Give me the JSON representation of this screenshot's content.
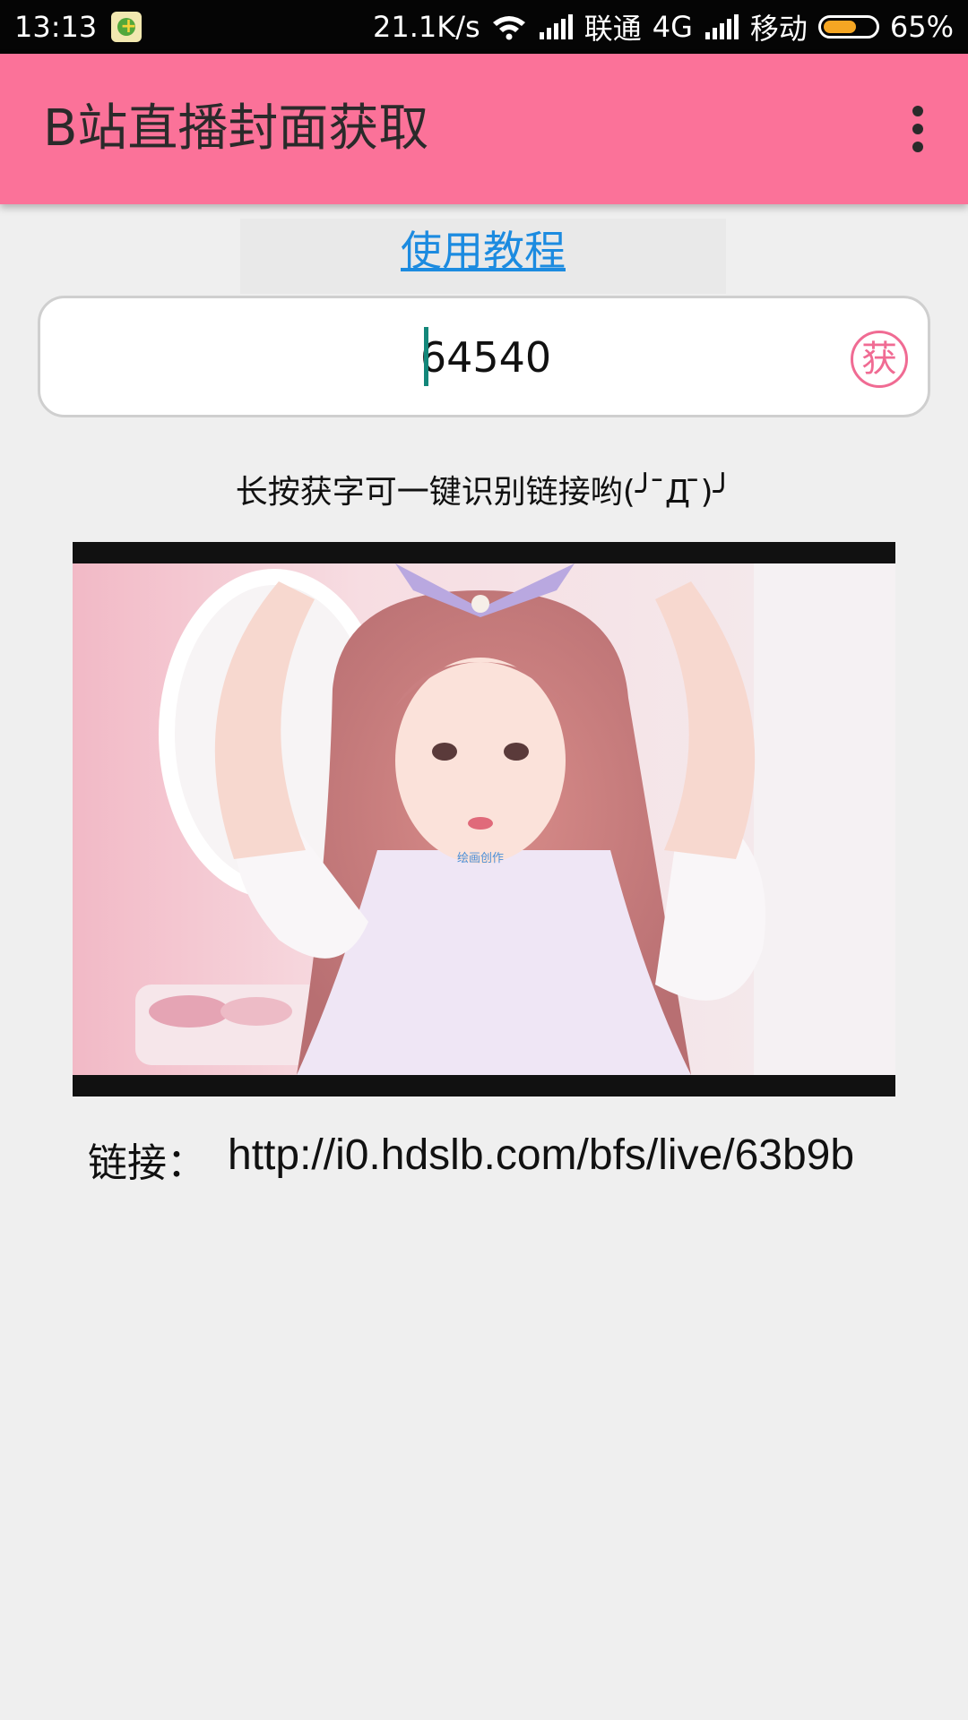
{
  "status_bar": {
    "time": "13:13",
    "net_speed": "21.1K/s",
    "carrier_1": "联通",
    "network_type": "4G",
    "carrier_2": "移动",
    "battery_percent": "65%",
    "battery_level": 0.65,
    "icons": [
      "app-notification-icon",
      "wifi-icon",
      "signal-icon",
      "battery-icon"
    ]
  },
  "toolbar": {
    "title": "B站直播封面获取",
    "overflow_icon": "more-vert-icon",
    "accent_color": "#fb7299"
  },
  "tutorial": {
    "label": "使用教程",
    "link_color": "#1c8be0"
  },
  "room_input": {
    "value": "64540"
  },
  "fetch_button": {
    "label": "获"
  },
  "hint": {
    "text": "长按获字可一键识别链接哟(╯ ̄Д ̄)╯"
  },
  "cover": {
    "watermark": "绘画创作"
  },
  "link_row": {
    "label": "链接：",
    "value": "http://i0.hdslb.com/bfs/live/63b9b"
  }
}
